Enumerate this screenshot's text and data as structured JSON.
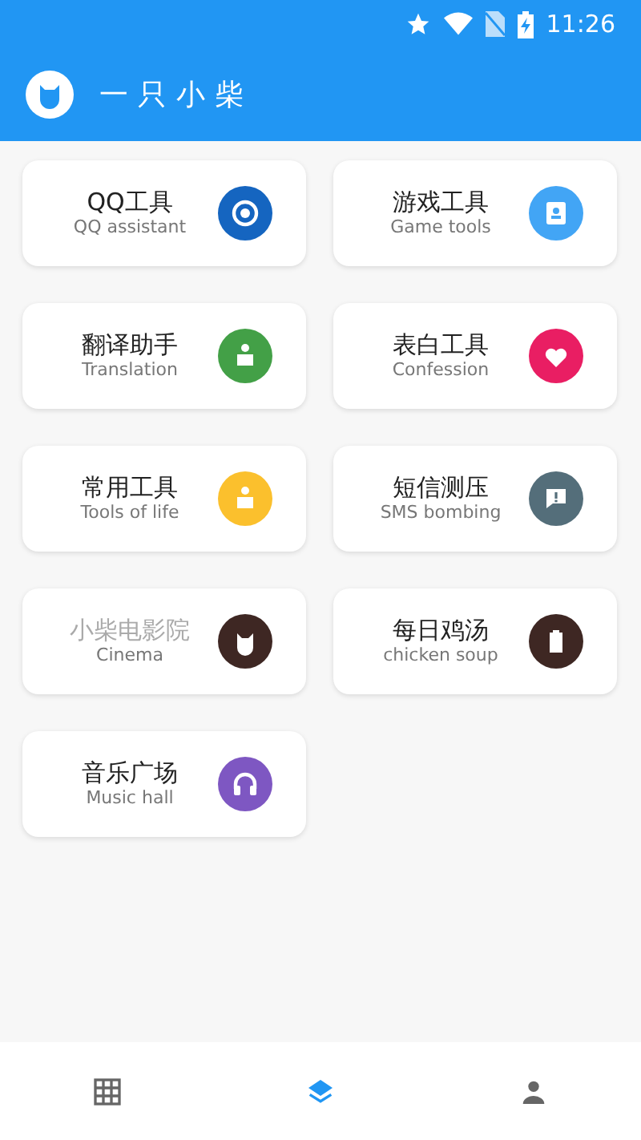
{
  "status_bar": {
    "time": "11:26"
  },
  "app_bar": {
    "title": "一只小柴"
  },
  "tools": [
    {
      "title": "QQ工具",
      "subtitle": "QQ assistant",
      "kind": "target",
      "color": "#1565c0",
      "disabled": false
    },
    {
      "title": "游戏工具",
      "subtitle": "Game tools",
      "kind": "contact",
      "color": "#42a5f5",
      "disabled": false
    },
    {
      "title": "翻译助手",
      "subtitle": "Translation",
      "kind": "person",
      "color": "#43a047",
      "disabled": false
    },
    {
      "title": "表白工具",
      "subtitle": "Confession",
      "kind": "heart",
      "color": "#e91e63",
      "disabled": false
    },
    {
      "title": "常用工具",
      "subtitle": "Tools of life",
      "kind": "person",
      "color": "#fbc02d",
      "disabled": false
    },
    {
      "title": "短信测压",
      "subtitle": "SMS bombing",
      "kind": "alert",
      "color": "#546e7a",
      "disabled": false
    },
    {
      "title": "小柴电影院",
      "subtitle": "Cinema",
      "kind": "cat",
      "color": "#3e2723",
      "disabled": true
    },
    {
      "title": "每日鸡汤",
      "subtitle": "chicken soup",
      "kind": "battery",
      "color": "#3e2723",
      "disabled": false
    },
    {
      "title": "音乐广场",
      "subtitle": "Music hall",
      "kind": "headphones",
      "color": "#7e57c2",
      "disabled": false
    }
  ],
  "bottom_nav": [
    {
      "kind": "grid",
      "selected": false
    },
    {
      "kind": "layers",
      "selected": true
    },
    {
      "kind": "person",
      "selected": false
    }
  ]
}
